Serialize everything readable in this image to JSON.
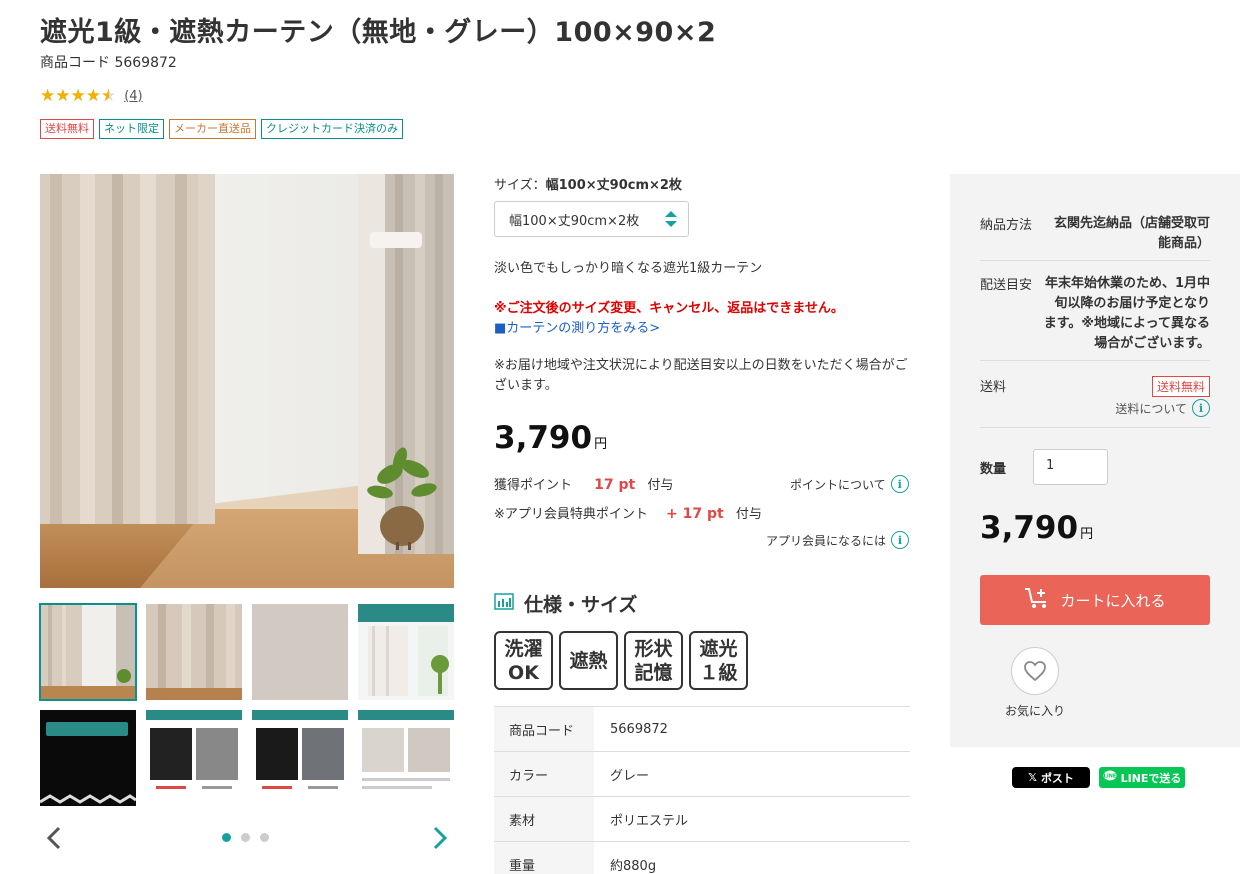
{
  "product": {
    "title": "遮光1級・遮熱カーテン（無地・グレー）100×90×2",
    "code_label": "商品コード",
    "code_value": "5669872",
    "rating_stars": 4.5,
    "review_count": "(4)",
    "badges": [
      "送料無料",
      "ネット限定",
      "メーカー直送品",
      "クレジットカード決済のみ"
    ]
  },
  "gallery": {
    "active_index": 0,
    "page_count": 3,
    "active_page": 0,
    "thumb5_caption": "淡い色でもしっかり遮光",
    "thumb4_caption": "淡く明るい色ならではの良さ"
  },
  "options": {
    "size_label_prefix": "サイズ：",
    "size_label_value": "幅100×丈90cm×2枚",
    "size_select_value": "幅100×丈90cm×2枚"
  },
  "description": {
    "catch": "淡い色でもしっかり暗くなる遮光1級カーテン",
    "warning": "※ご注文後のサイズ変更、キャンセル、返品はできません。",
    "measure_link": "■カーテンの測り方をみる>",
    "delivery_note": "※お届け地域や注文状況により配送目安以上の日数をいただく場合がございます。"
  },
  "price": {
    "amount": "3,790",
    "unit": "円"
  },
  "points": {
    "earn_label": "獲得ポイント",
    "earn_value": "17 pt",
    "earn_suffix": "付与",
    "about_points_link": "ポイントについて",
    "app_label": "※アプリ会員特典ポイント",
    "app_value": "+ 17 pt",
    "app_suffix": "付与",
    "app_member_link": "アプリ会員になるには"
  },
  "spec": {
    "heading": "仕様・サイズ",
    "icons": [
      {
        "line1": "洗濯",
        "line2": "OK"
      },
      {
        "line1": "遮熱",
        "line2": ""
      },
      {
        "line1": "形状",
        "line2": "記憶"
      },
      {
        "line1": "遮光",
        "line2": "１級"
      }
    ],
    "rows": [
      {
        "key": "商品コード",
        "value": "5669872"
      },
      {
        "key": "カラー",
        "value": "グレー"
      },
      {
        "key": "素材",
        "value": "ポリエステル"
      },
      {
        "key": "重量",
        "value": "約880g"
      }
    ]
  },
  "panel": {
    "delivery_method_label": "納品方法",
    "delivery_method_value": "玄関先迄納品（店舗受取可能商品）",
    "delivery_eta_label": "配送目安",
    "delivery_eta_value": "年末年始休業のため、1月中旬以降のお届け予定となります。※地域によって異なる場合がございます。",
    "shipping_label": "送料",
    "shipping_badge": "送料無料",
    "shipping_about": "送料について",
    "quantity_label": "数量",
    "quantity_value": "1",
    "price_amount": "3,790",
    "price_unit": "円",
    "cart_button": "カートに入れる",
    "favorite_label": "お気に入り"
  },
  "share": {
    "x_label": "ポスト",
    "line_label": "LINEで送る"
  },
  "colors": {
    "accent_teal": "#17a0a0",
    "cart_red": "#ea6458",
    "warning_red": "#e00000",
    "link_blue": "#1a5fc4"
  }
}
